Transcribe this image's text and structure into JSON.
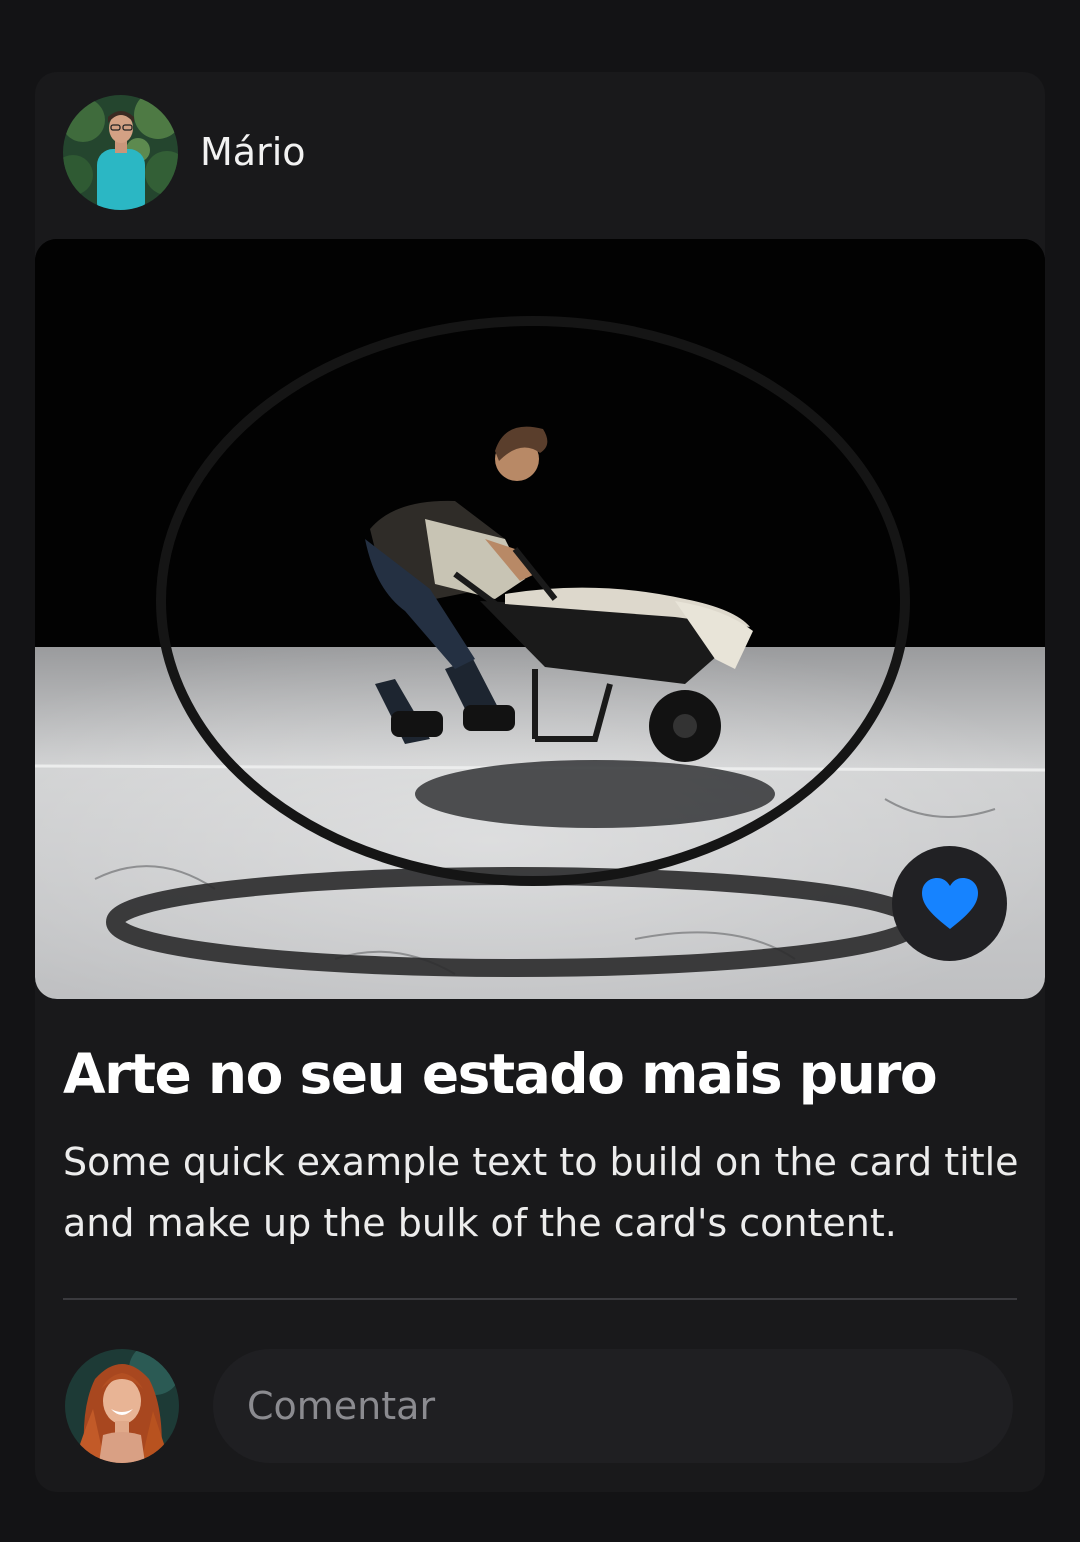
{
  "post": {
    "author": {
      "name": "Mário",
      "avatar_icon": "user-avatar-man-teal-shirt"
    },
    "image": {
      "icon": "photo-man-with-wheelbarrow-inside-ring"
    },
    "like": {
      "icon": "heart-icon",
      "liked": true,
      "color": "#1683ff"
    },
    "title": "Arte no seu estado mais puro",
    "text": "Some quick example text to build on the card title and make up the bulk of the card's content."
  },
  "comment": {
    "avatar_icon": "user-avatar-woman-red-hair",
    "placeholder": "Comentar",
    "value": ""
  },
  "colors": {
    "background": "#131315",
    "card": "#19191b",
    "accent": "#1683ff"
  }
}
